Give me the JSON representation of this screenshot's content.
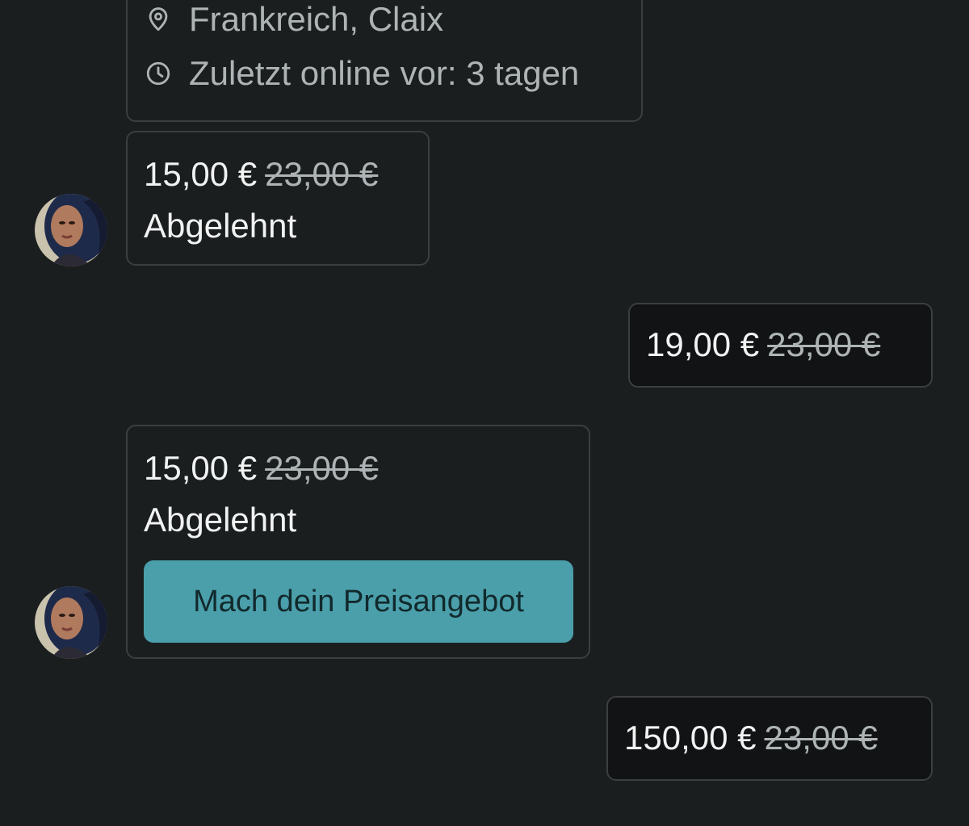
{
  "profile": {
    "location_icon": "location-pin-icon",
    "location": "Frankreich, Claix",
    "last_online_icon": "clock-icon",
    "last_online": "Zuletzt online vor: 3 tagen"
  },
  "messages": [
    {
      "sender": "seller",
      "offer_price": "15,00 €",
      "original_price": "23,00 €",
      "status": "Abgelehnt"
    },
    {
      "sender": "me",
      "offer_price": "19,00 €",
      "original_price": "23,00 €"
    },
    {
      "sender": "seller",
      "offer_price": "15,00 €",
      "original_price": "23,00 €",
      "status": "Abgelehnt",
      "action_label": "Mach dein Preisangebot"
    },
    {
      "sender": "me",
      "offer_price": "150,00 €",
      "original_price": "23,00 €"
    }
  ],
  "colors": {
    "background": "#1b1e1f",
    "card_border": "#3b3f41",
    "outgoing_bg": "#111314",
    "accent": "#4a9fab",
    "muted_text": "#aeb4b5"
  }
}
